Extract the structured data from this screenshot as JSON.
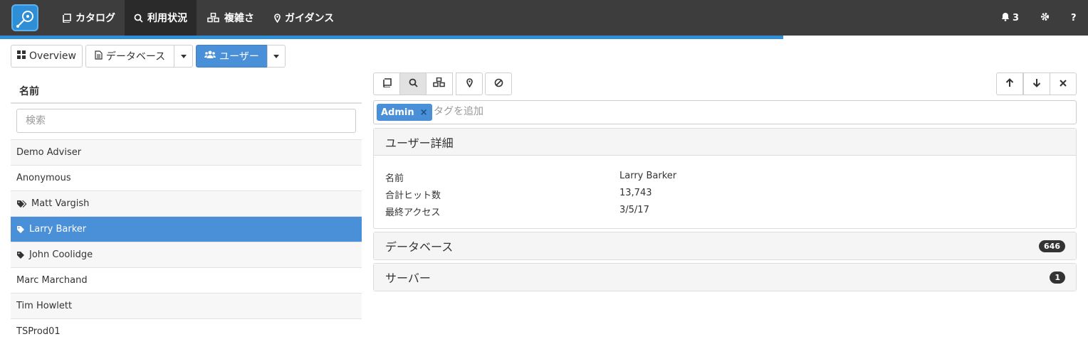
{
  "navbar": {
    "items": [
      {
        "label": "カタログ",
        "icon": "book-icon"
      },
      {
        "label": "利用状況",
        "icon": "search-icon"
      },
      {
        "label": "複雑さ",
        "icon": "cubes-icon"
      },
      {
        "label": "ガイダンス",
        "icon": "map-marker-icon"
      }
    ],
    "notifications_count": "3",
    "help_label": "?",
    "progress_percent": 72
  },
  "toolbar": {
    "overview_label": "Overview",
    "database_label": "データベース",
    "users_label": "ユーザー"
  },
  "list": {
    "header": "名前",
    "search_placeholder": "検索",
    "rows": [
      {
        "label": "Demo Adviser",
        "tag": "none"
      },
      {
        "label": "Anonymous",
        "tag": "none"
      },
      {
        "label": "Matt Vargish",
        "tag": "tags"
      },
      {
        "label": "Larry Barker",
        "tag": "tag",
        "selected": true
      },
      {
        "label": "John Coolidge",
        "tag": "tag"
      },
      {
        "label": "Marc Marchand",
        "tag": "none"
      },
      {
        "label": "Tim Howlett",
        "tag": "none"
      },
      {
        "label": "TSProd01",
        "tag": "none"
      }
    ]
  },
  "detail": {
    "tag": "Admin",
    "tag_remove": "×",
    "tag_placeholder": "タグを追加",
    "user_panel_title": "ユーザー詳細",
    "fields": [
      {
        "label": "名前",
        "value": "Larry Barker"
      },
      {
        "label": "合計ヒット数",
        "value": "13,743"
      },
      {
        "label": "最終アクセス",
        "value": "3/5/17"
      }
    ],
    "database_panel_title": "データベース",
    "database_count": "646",
    "server_panel_title": "サーバー",
    "server_count": "1"
  },
  "colors": {
    "navbar_bg": "#3d3d3d",
    "accent": "#4a90d9",
    "badge_bg": "#333333"
  }
}
